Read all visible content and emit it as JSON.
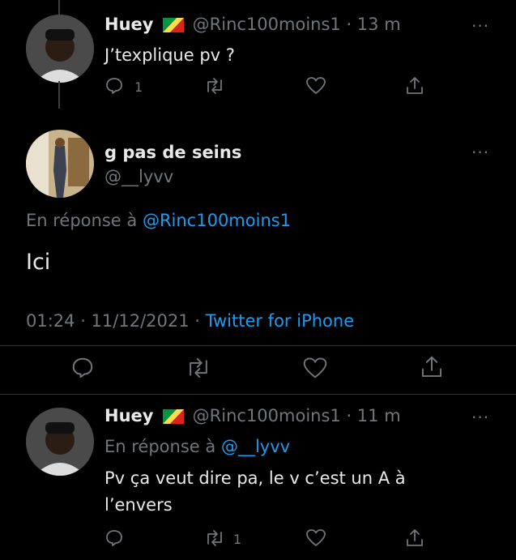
{
  "tweet1": {
    "name": "Huey",
    "handle_time": "@Rinc100moins1 · 13 m",
    "text": "J’texplique pv ?",
    "reply_count": "1",
    "more_label": "···"
  },
  "main_tweet": {
    "name": "g pas de seins",
    "handle": "@__lyvv",
    "reply_prefix": "En réponse à",
    "reply_to": "@Rinc100moins1",
    "text": "Ici",
    "datetime": "01:24 · 11/12/2021 ·",
    "source": "Twitter for iPhone",
    "more_label": "···"
  },
  "tweet3": {
    "name": "Huey",
    "handle_time": "@Rinc100moins1 · 11 m",
    "reply_prefix": "En réponse à",
    "reply_to": "@__lyvv",
    "text_line1": "Pv ça veut dire pa, le v c’est un A à",
    "text_line2": "l’envers",
    "retweet_count": "1",
    "more_label": "···"
  },
  "icons": [
    "reply-icon",
    "retweet-icon",
    "like-icon",
    "share-icon",
    "more-icon",
    "flag-icon"
  ],
  "colors": {
    "background": "#000000",
    "text": "#e7e9ea",
    "muted": "#71767b",
    "link": "#1d9bf0"
  }
}
